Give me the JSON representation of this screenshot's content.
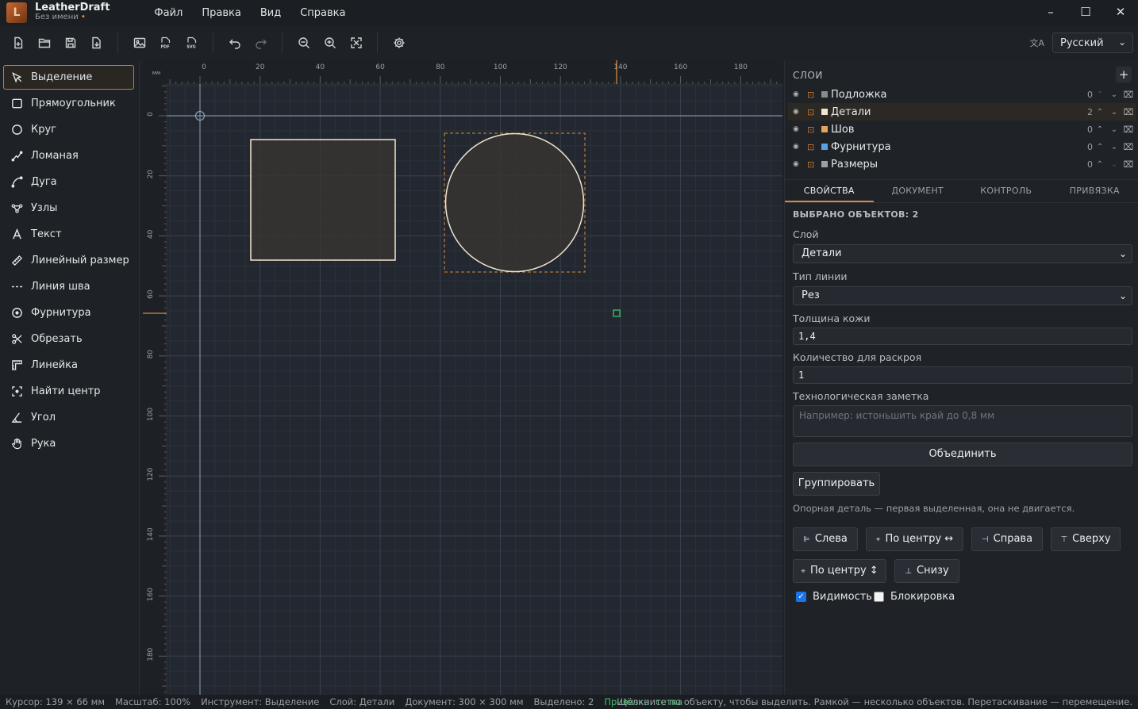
{
  "app": {
    "name": "LeatherDraft",
    "document": "Без имени",
    "modified_marker": "•",
    "logo_glyph": "L"
  },
  "menu": [
    "Файл",
    "Правка",
    "Вид",
    "Справка"
  ],
  "window_controls": {
    "minimize": "–",
    "maximize": "☐",
    "close": "✕"
  },
  "toolbar": {
    "buttons": [
      "new-file-icon",
      "open-folder-icon",
      "save-icon",
      "save-as-icon",
      "export-image-icon",
      "export-pdf-icon",
      "export-svg-icon",
      "undo-icon",
      "redo-icon",
      "zoom-out-icon",
      "zoom-in-icon",
      "fit-view-icon",
      "settings-icon"
    ],
    "language_icon_text": "文A",
    "language": "Русский"
  },
  "tools": [
    {
      "icon": "select-arrow-icon",
      "label": "Выделение",
      "active": true
    },
    {
      "icon": "rectangle-icon",
      "label": "Прямоугольник"
    },
    {
      "icon": "circle-icon",
      "label": "Круг"
    },
    {
      "icon": "polyline-icon",
      "label": "Ломаная"
    },
    {
      "icon": "arc-icon",
      "label": "Дуга"
    },
    {
      "icon": "nodes-icon",
      "label": "Узлы"
    },
    {
      "icon": "text-icon",
      "label": "Текст"
    },
    {
      "icon": "ruler-dimension-icon",
      "label": "Линейный размер"
    },
    {
      "icon": "seam-line-icon",
      "label": "Линия шва"
    },
    {
      "icon": "hardware-icon",
      "label": "Фурнитура"
    },
    {
      "icon": "scissors-icon",
      "label": "Обрезать"
    },
    {
      "icon": "ruler-icon",
      "label": "Линейка"
    },
    {
      "icon": "find-center-icon",
      "label": "Найти центр"
    },
    {
      "icon": "angle-icon",
      "label": "Угол"
    },
    {
      "icon": "hand-icon",
      "label": "Рука"
    }
  ],
  "canvas": {
    "unit_label": "мм",
    "h_ticks": [
      "0",
      "20",
      "40",
      "60",
      "80",
      "100",
      "120",
      "140",
      "160",
      "180"
    ],
    "v_ticks": [
      "0",
      "20",
      "40",
      "60",
      "80",
      "100",
      "120",
      "140",
      "160",
      "180"
    ]
  },
  "layers": {
    "title": "СЛОИ",
    "add_label": "+",
    "items": [
      {
        "name": "Подложка",
        "color": "#8a8a8a",
        "count": "0",
        "selected": false,
        "up_enabled": false,
        "down_enabled": true
      },
      {
        "name": "Детали",
        "color": "#f0e6d2",
        "count": "2",
        "selected": true,
        "up_enabled": true,
        "down_enabled": true
      },
      {
        "name": "Шов",
        "color": "#e8a35a",
        "count": "0",
        "selected": false,
        "up_enabled": true,
        "down_enabled": true
      },
      {
        "name": "Фурнитура",
        "color": "#5aa0e8",
        "count": "0",
        "selected": false,
        "up_enabled": true,
        "down_enabled": true
      },
      {
        "name": "Размеры",
        "color": "#9aa0a6",
        "count": "0",
        "selected": false,
        "up_enabled": true,
        "down_enabled": false
      }
    ]
  },
  "tabs": [
    "СВОЙСТВА",
    "ДОКУМЕНТ",
    "КОНТРОЛЬ",
    "ПРИВЯЗКА"
  ],
  "properties": {
    "selected_count": "ВЫБРАНО ОБЪЕКТОВ: 2",
    "layer_label": "Слой",
    "layer_value": "Детали",
    "line_type_label": "Тип линии",
    "line_type_value": "Рез",
    "thickness_label": "Толщина кожи",
    "thickness_value": "1,4",
    "quantity_label": "Количество для раскроя",
    "quantity_value": "1",
    "note_label": "Технологическая заметка",
    "note_placeholder": "Например: истоньшить край до 0,8 мм",
    "merge_button": "Объединить",
    "group_button": "Группировать",
    "align_hint": "Опорная деталь — первая выделенная, она не двигается.",
    "align_buttons": [
      {
        "icon": "align-left-icon",
        "glyph": "⊫",
        "label": "Слева"
      },
      {
        "icon": "align-center-h-icon",
        "glyph": "⌖",
        "label": "По центру ↔"
      },
      {
        "icon": "align-right-icon",
        "glyph": "⊣",
        "label": "Справа"
      },
      {
        "icon": "align-top-icon",
        "glyph": "⊤",
        "label": "Сверху"
      },
      {
        "icon": "align-center-v-icon",
        "glyph": "⌖",
        "label": "По центру ↕"
      },
      {
        "icon": "align-bottom-icon",
        "glyph": "⊥",
        "label": "Снизу"
      }
    ],
    "visibility_label": "Видимость",
    "visibility_checked": true,
    "lock_label": "Блокировка",
    "lock_checked": false
  },
  "status": {
    "cursor": "Курсор: 139 × 66 мм",
    "zoom": "Масштаб: 100%",
    "tool": "Инструмент: Выделение",
    "layer": "Слой: Детали",
    "document": "Документ: 300 × 300 мм",
    "selected": "Выделено: 2",
    "snap": "Привязка: сетка",
    "hint": "Щёлкните по объекту, чтобы выделить. Рамкой — несколько объектов. Перетаскивание — перемещение."
  }
}
